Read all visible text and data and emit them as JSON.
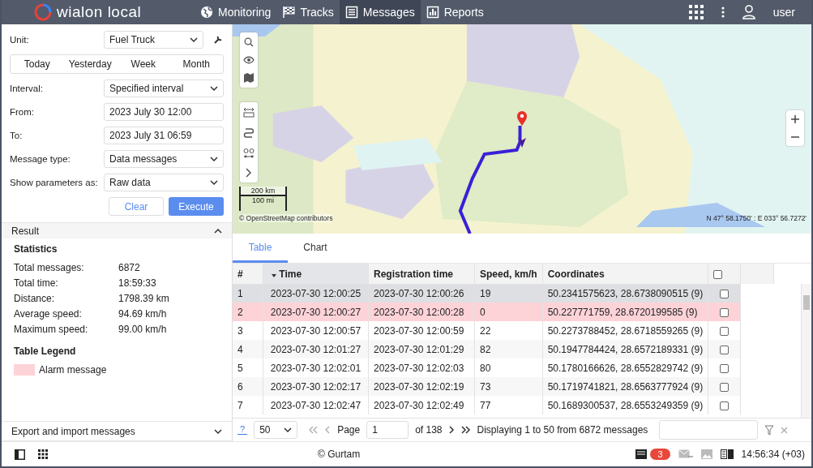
{
  "header": {
    "logo": "wialon local",
    "nav": [
      {
        "label": "Monitoring",
        "selected": false
      },
      {
        "label": "Tracks",
        "selected": false
      },
      {
        "label": "Messages",
        "selected": true
      },
      {
        "label": "Reports",
        "selected": false
      }
    ],
    "user": "user"
  },
  "form": {
    "unit_label": "Unit:",
    "unit": "Fuel Truck",
    "periods": [
      "Today",
      "Yesterday",
      "Week",
      "Month"
    ],
    "fields": [
      {
        "label": "Interval:",
        "value": "Specified interval",
        "kind": "select"
      },
      {
        "label": "From:",
        "value": "2023 July 30 12:00",
        "kind": "input"
      },
      {
        "label": "To:",
        "value": "2023 July 31 06:59",
        "kind": "input"
      },
      {
        "label": "Message type:",
        "value": "Data messages",
        "kind": "select"
      },
      {
        "label": "Show parameters as:",
        "value": "Raw data",
        "kind": "select"
      }
    ],
    "buttons": {
      "clear": "Clear",
      "execute": "Execute"
    }
  },
  "result": {
    "title": "Result",
    "expanded": true,
    "statistics_title": "Statistics",
    "statistics": [
      {
        "label": "Total messages:",
        "value": "6872"
      },
      {
        "label": "Total time:",
        "value": "18:59:33"
      },
      {
        "label": "Distance:",
        "value": "1798.39 km"
      },
      {
        "label": "Average speed:",
        "value": "94.69 km/h"
      },
      {
        "label": "Maximum speed:",
        "value": "99.00 km/h"
      }
    ],
    "legend_title": "Table Legend",
    "legend": [
      {
        "label": "Alarm message",
        "color": "#fdd3d8"
      }
    ]
  },
  "export": {
    "title": "Export and import messages",
    "expanded": false
  },
  "map": {
    "scale_km": "200 km",
    "scale_mi": "100 mi",
    "attribution": "© OpenStreetMap contributors",
    "coordinates": "N 47° 58.1750' : E 033° 56.7272'"
  },
  "tabs": [
    {
      "label": "Table",
      "selected": true
    },
    {
      "label": "Chart",
      "selected": false
    }
  ],
  "table": {
    "columns": [
      {
        "label": "#",
        "sorted": false
      },
      {
        "label": "Time",
        "sorted": true
      },
      {
        "label": "Registration time",
        "sorted": false
      },
      {
        "label": "Speed, km/h",
        "sorted": false
      },
      {
        "label": "Coordinates",
        "sorted": false
      }
    ],
    "select_all_checked": false,
    "rows": [
      {
        "cells": [
          "1",
          "2023-07-30 12:00:25",
          "2023-07-30 12:00:26",
          "19",
          "50.2341575623, 28.6738090515 (9)"
        ],
        "selected": true,
        "alarm": false,
        "checked": false
      },
      {
        "cells": [
          "2",
          "2023-07-30 12:00:27",
          "2023-07-30 12:00:28",
          "0",
          "50.227771759, 28.6720199585 (9)"
        ],
        "selected": false,
        "alarm": true,
        "checked": false
      },
      {
        "cells": [
          "3",
          "2023-07-30 12:00:57",
          "2023-07-30 12:00:59",
          "22",
          "50.2273788452, 28.6718559265 (9)"
        ],
        "selected": false,
        "alarm": false,
        "checked": false
      },
      {
        "cells": [
          "4",
          "2023-07-30 12:01:27",
          "2023-07-30 12:01:29",
          "82",
          "50.1947784424, 28.6572189331 (9)"
        ],
        "selected": false,
        "alarm": false,
        "checked": false
      },
      {
        "cells": [
          "5",
          "2023-07-30 12:02:01",
          "2023-07-30 12:02:03",
          "80",
          "50.1780166626, 28.6552829742 (9)"
        ],
        "selected": false,
        "alarm": false,
        "checked": false
      },
      {
        "cells": [
          "6",
          "2023-07-30 12:02:17",
          "2023-07-30 12:02:19",
          "73",
          "50.1719741821, 28.6563777924 (9)"
        ],
        "selected": false,
        "alarm": false,
        "checked": false
      },
      {
        "cells": [
          "7",
          "2023-07-30 12:02:47",
          "2023-07-30 12:02:49",
          "77",
          "50.1689300537, 28.6553249359 (9)"
        ],
        "selected": false,
        "alarm": false,
        "checked": false
      }
    ]
  },
  "pager": {
    "help": "?",
    "page_size": "50",
    "page_label": "Page",
    "page": "1",
    "of": "of 138",
    "summary": "Displaying 1 to 50 from 6872 messages"
  },
  "status": {
    "copyright": "© Gurtam",
    "badge": "3",
    "time": "14:56:34 (+03)"
  }
}
